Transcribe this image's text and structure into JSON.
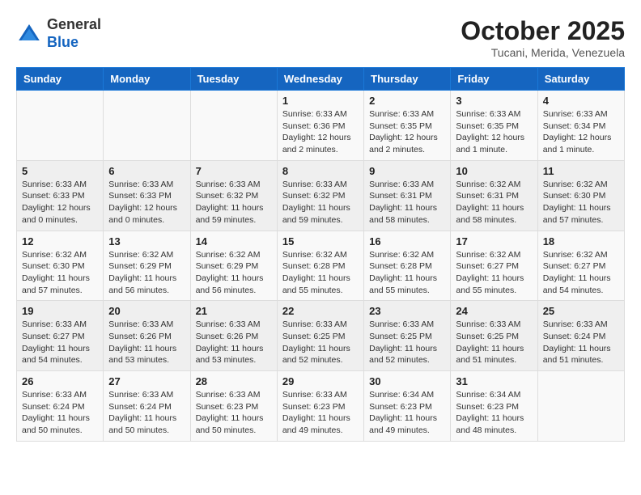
{
  "header": {
    "logo_general": "General",
    "logo_blue": "Blue",
    "month_title": "October 2025",
    "location": "Tucani, Merida, Venezuela"
  },
  "days_of_week": [
    "Sunday",
    "Monday",
    "Tuesday",
    "Wednesday",
    "Thursday",
    "Friday",
    "Saturday"
  ],
  "weeks": [
    [
      {
        "day": "",
        "info": ""
      },
      {
        "day": "",
        "info": ""
      },
      {
        "day": "",
        "info": ""
      },
      {
        "day": "1",
        "info": "Sunrise: 6:33 AM\nSunset: 6:36 PM\nDaylight: 12 hours\nand 2 minutes."
      },
      {
        "day": "2",
        "info": "Sunrise: 6:33 AM\nSunset: 6:35 PM\nDaylight: 12 hours\nand 2 minutes."
      },
      {
        "day": "3",
        "info": "Sunrise: 6:33 AM\nSunset: 6:35 PM\nDaylight: 12 hours\nand 1 minute."
      },
      {
        "day": "4",
        "info": "Sunrise: 6:33 AM\nSunset: 6:34 PM\nDaylight: 12 hours\nand 1 minute."
      }
    ],
    [
      {
        "day": "5",
        "info": "Sunrise: 6:33 AM\nSunset: 6:33 PM\nDaylight: 12 hours\nand 0 minutes."
      },
      {
        "day": "6",
        "info": "Sunrise: 6:33 AM\nSunset: 6:33 PM\nDaylight: 12 hours\nand 0 minutes."
      },
      {
        "day": "7",
        "info": "Sunrise: 6:33 AM\nSunset: 6:32 PM\nDaylight: 11 hours\nand 59 minutes."
      },
      {
        "day": "8",
        "info": "Sunrise: 6:33 AM\nSunset: 6:32 PM\nDaylight: 11 hours\nand 59 minutes."
      },
      {
        "day": "9",
        "info": "Sunrise: 6:33 AM\nSunset: 6:31 PM\nDaylight: 11 hours\nand 58 minutes."
      },
      {
        "day": "10",
        "info": "Sunrise: 6:32 AM\nSunset: 6:31 PM\nDaylight: 11 hours\nand 58 minutes."
      },
      {
        "day": "11",
        "info": "Sunrise: 6:32 AM\nSunset: 6:30 PM\nDaylight: 11 hours\nand 57 minutes."
      }
    ],
    [
      {
        "day": "12",
        "info": "Sunrise: 6:32 AM\nSunset: 6:30 PM\nDaylight: 11 hours\nand 57 minutes."
      },
      {
        "day": "13",
        "info": "Sunrise: 6:32 AM\nSunset: 6:29 PM\nDaylight: 11 hours\nand 56 minutes."
      },
      {
        "day": "14",
        "info": "Sunrise: 6:32 AM\nSunset: 6:29 PM\nDaylight: 11 hours\nand 56 minutes."
      },
      {
        "day": "15",
        "info": "Sunrise: 6:32 AM\nSunset: 6:28 PM\nDaylight: 11 hours\nand 55 minutes."
      },
      {
        "day": "16",
        "info": "Sunrise: 6:32 AM\nSunset: 6:28 PM\nDaylight: 11 hours\nand 55 minutes."
      },
      {
        "day": "17",
        "info": "Sunrise: 6:32 AM\nSunset: 6:27 PM\nDaylight: 11 hours\nand 55 minutes."
      },
      {
        "day": "18",
        "info": "Sunrise: 6:32 AM\nSunset: 6:27 PM\nDaylight: 11 hours\nand 54 minutes."
      }
    ],
    [
      {
        "day": "19",
        "info": "Sunrise: 6:33 AM\nSunset: 6:27 PM\nDaylight: 11 hours\nand 54 minutes."
      },
      {
        "day": "20",
        "info": "Sunrise: 6:33 AM\nSunset: 6:26 PM\nDaylight: 11 hours\nand 53 minutes."
      },
      {
        "day": "21",
        "info": "Sunrise: 6:33 AM\nSunset: 6:26 PM\nDaylight: 11 hours\nand 53 minutes."
      },
      {
        "day": "22",
        "info": "Sunrise: 6:33 AM\nSunset: 6:25 PM\nDaylight: 11 hours\nand 52 minutes."
      },
      {
        "day": "23",
        "info": "Sunrise: 6:33 AM\nSunset: 6:25 PM\nDaylight: 11 hours\nand 52 minutes."
      },
      {
        "day": "24",
        "info": "Sunrise: 6:33 AM\nSunset: 6:25 PM\nDaylight: 11 hours\nand 51 minutes."
      },
      {
        "day": "25",
        "info": "Sunrise: 6:33 AM\nSunset: 6:24 PM\nDaylight: 11 hours\nand 51 minutes."
      }
    ],
    [
      {
        "day": "26",
        "info": "Sunrise: 6:33 AM\nSunset: 6:24 PM\nDaylight: 11 hours\nand 50 minutes."
      },
      {
        "day": "27",
        "info": "Sunrise: 6:33 AM\nSunset: 6:24 PM\nDaylight: 11 hours\nand 50 minutes."
      },
      {
        "day": "28",
        "info": "Sunrise: 6:33 AM\nSunset: 6:23 PM\nDaylight: 11 hours\nand 50 minutes."
      },
      {
        "day": "29",
        "info": "Sunrise: 6:33 AM\nSunset: 6:23 PM\nDaylight: 11 hours\nand 49 minutes."
      },
      {
        "day": "30",
        "info": "Sunrise: 6:34 AM\nSunset: 6:23 PM\nDaylight: 11 hours\nand 49 minutes."
      },
      {
        "day": "31",
        "info": "Sunrise: 6:34 AM\nSunset: 6:23 PM\nDaylight: 11 hours\nand 48 minutes."
      },
      {
        "day": "",
        "info": ""
      }
    ]
  ]
}
